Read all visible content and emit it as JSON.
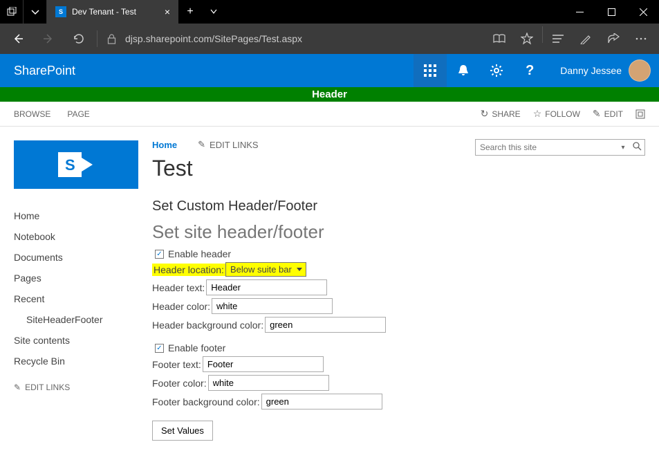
{
  "browser": {
    "tab_title": "Dev Tenant - Test",
    "url": "djsp.sharepoint.com/SitePages/Test.aspx"
  },
  "suite": {
    "brand": "SharePoint",
    "user_name": "Danny Jessee"
  },
  "custom_header": {
    "text": "Header"
  },
  "ribbon": {
    "tabs": {
      "browse": "BROWSE",
      "page": "PAGE"
    },
    "actions": {
      "share": "SHARE",
      "follow": "FOLLOW",
      "edit": "EDIT"
    }
  },
  "breadcrumb": {
    "home": "Home",
    "edit_links": "EDIT LINKS"
  },
  "page_title": "Test",
  "search": {
    "placeholder": "Search this site"
  },
  "left_nav": {
    "items": [
      "Home",
      "Notebook",
      "Documents",
      "Pages",
      "Recent"
    ],
    "recent_child": "SiteHeaderFooter",
    "items2": [
      "Site contents",
      "Recycle Bin"
    ],
    "edit_links": "EDIT LINKS"
  },
  "form": {
    "heading1": "Set Custom Header/Footer",
    "heading2": "Set site header/footer",
    "enable_header": "Enable header",
    "header_location_label": "Header location:",
    "header_location_value": "Below suite bar",
    "header_text_label": "Header text:",
    "header_text_value": "Header",
    "header_color_label": "Header color:",
    "header_color_value": "white",
    "header_bg_label": "Header background color:",
    "header_bg_value": "green",
    "enable_footer": "Enable footer",
    "footer_text_label": "Footer text:",
    "footer_text_value": "Footer",
    "footer_color_label": "Footer color:",
    "footer_color_value": "white",
    "footer_bg_label": "Footer background color:",
    "footer_bg_value": "green",
    "submit": "Set Values"
  }
}
